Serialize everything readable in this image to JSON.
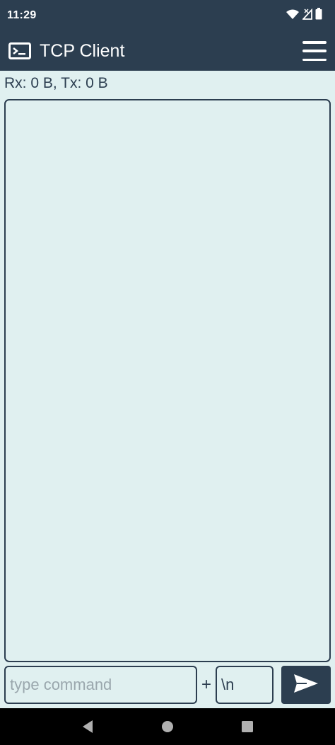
{
  "status_bar": {
    "time": "11:29",
    "icons": [
      "wifi-icon",
      "signal-icon",
      "battery-icon"
    ]
  },
  "app_bar": {
    "title": "TCP Client",
    "app_icon": "terminal-icon",
    "menu_icon": "hamburger-menu-icon"
  },
  "counter": {
    "text": "Rx: 0 B, Tx: 0 B"
  },
  "input_row": {
    "command_placeholder": "type command",
    "command_value": "",
    "plus": "+",
    "suffix_value": "\\n",
    "send_icon": "send-icon"
  },
  "nav_bar": {
    "buttons": [
      "back-icon",
      "home-icon",
      "recents-icon"
    ]
  },
  "colors": {
    "primary": "#2c3e50",
    "background": "#e0f0f0",
    "placeholder": "#9aa7ad"
  }
}
